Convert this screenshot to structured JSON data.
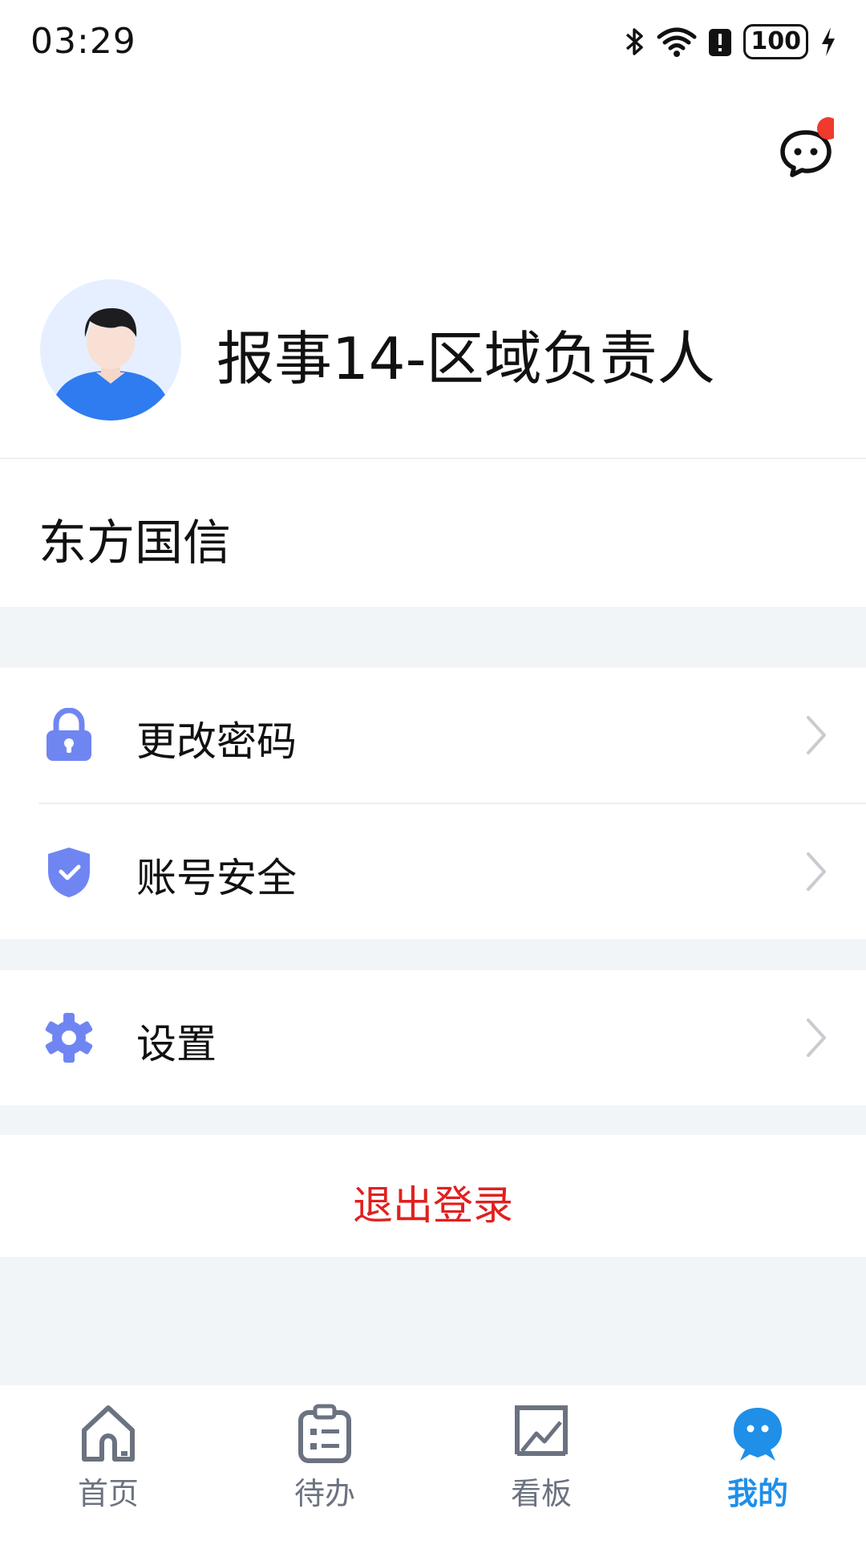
{
  "status_bar": {
    "time": "03:29",
    "battery": "100",
    "icons": [
      "bluetooth-icon",
      "wifi-icon",
      "alert-icon",
      "battery-icon",
      "charging-icon"
    ]
  },
  "header": {
    "message_icon": "chat-bubble-icon",
    "has_unread_badge": true,
    "user_name": "报事14-区域负责人"
  },
  "organization": {
    "name": "东方国信"
  },
  "menu": {
    "groups": [
      [
        {
          "label": "更改密码",
          "icon": "lock-icon"
        },
        {
          "label": "账号安全",
          "icon": "shield-icon"
        }
      ],
      [
        {
          "label": "设置",
          "icon": "gear-icon"
        }
      ]
    ]
  },
  "logout": {
    "label": "退出登录"
  },
  "tabbar": {
    "tabs": [
      {
        "label": "首页",
        "icon": "home-icon",
        "active": false
      },
      {
        "label": "待办",
        "icon": "clipboard-icon",
        "active": false
      },
      {
        "label": "看板",
        "icon": "chart-icon",
        "active": false
      },
      {
        "label": "我的",
        "icon": "profile-icon",
        "active": true
      }
    ]
  },
  "colors": {
    "accent": "#1f8fe8",
    "logout": "#e02020",
    "icon_fill": "#6f86f2",
    "badge": "#f03a2e",
    "background": "#f2f5f8"
  }
}
